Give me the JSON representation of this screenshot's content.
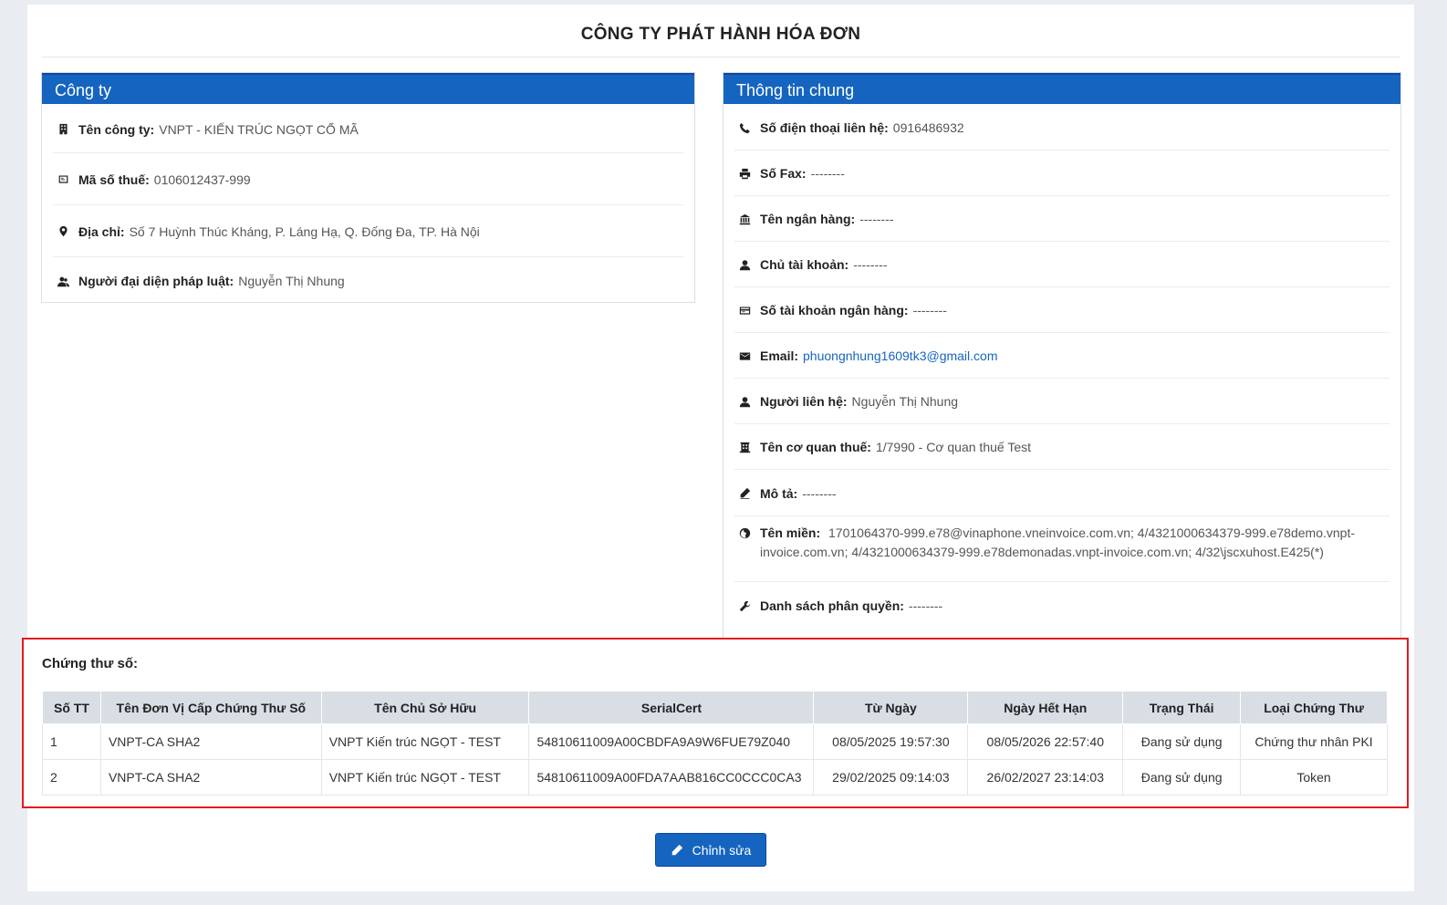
{
  "page_title": "CÔNG TY PHÁT HÀNH HÓA ĐƠN",
  "company_panel": {
    "title": "Công ty",
    "rows": [
      {
        "icon": "building-icon",
        "label": "Tên công ty:",
        "value": "VNPT - KIẾN TRÚC NGỌT CỔ MÃ"
      },
      {
        "icon": "id-card-icon",
        "label": "Mã số thuế:",
        "value": "0106012437-999"
      },
      {
        "icon": "map-marker-icon",
        "label": "Địa chỉ:",
        "value": "Số 7 Huỳnh Thúc Kháng, P. Láng Hạ, Q. Đống Đa, TP. Hà Nội"
      },
      {
        "icon": "users-icon",
        "label": "Người đại diện pháp luật:",
        "value": "Nguyễn Thị Nhung"
      }
    ]
  },
  "general_panel": {
    "title": "Thông tin chung",
    "rows": [
      {
        "icon": "phone-icon",
        "label": "Số điện thoại liên hệ:",
        "value": "0916486932"
      },
      {
        "icon": "fax-icon",
        "label": "Số Fax:",
        "value": "--------"
      },
      {
        "icon": "bank-icon",
        "label": "Tên ngân hàng:",
        "value": "--------"
      },
      {
        "icon": "user-icon",
        "label": "Chủ tài khoản:",
        "value": "--------"
      },
      {
        "icon": "credit-card-icon",
        "label": "Số tài khoản ngân hàng:",
        "value": "--------"
      },
      {
        "icon": "envelope-icon",
        "label": "Email:",
        "value": "phuongnhung1609tk3@gmail.com"
      },
      {
        "icon": "user-icon",
        "label": "Người liên hệ:",
        "value": "Nguyễn Thị Nhung"
      },
      {
        "icon": "building-icon",
        "label": "Tên cơ quan thuế:",
        "value": "1/7990 - Cơ quan thuế Test"
      },
      {
        "icon": "pencil-icon",
        "label": "Mô tả:",
        "value": "--------"
      },
      {
        "icon": "globe-icon",
        "label": "Tên miền:",
        "value": "1701064370-999.e78@vinaphone.vneinvoice.com.vn; 4/4321000634379-999.e78demo.vnpt-invoice.com.vn; 4/4321000634379-999.e78demonadas.vnpt-invoice.com.vn; 4/32\\jscxuhost.E425(*)"
      },
      {
        "icon": "wrench-icon",
        "label": "Danh sách phân quyền:",
        "value": "--------"
      }
    ]
  },
  "certificates": {
    "title": "Chứng thư số:",
    "columns": [
      "Số TT",
      "Tên Đơn Vị Cấp Chứng Thư Số",
      "Tên Chủ Sở Hữu",
      "SerialCert",
      "Từ Ngày",
      "Ngày Hết Hạn",
      "Trạng Thái",
      "Loại Chứng Thư"
    ],
    "rows": [
      [
        "1",
        "VNPT-CA SHA2",
        "VNPT Kiến trúc NGỌT - TEST",
        "54810611009A00CBDFA9A9W6FUE79Z040",
        "08/05/2025 19:57:30",
        "08/05/2026 22:57:40",
        "Đang sử dụng",
        "Chứng thư nhân PKI"
      ],
      [
        "2",
        "VNPT-CA SHA2",
        "VNPT Kiến trúc NGỌT - TEST",
        "54810611009A00FDA7AAB816CC0CCC0CA3",
        "29/02/2025 09:14:03",
        "26/02/2027 23:14:03",
        "Đang sử dụng",
        "Token"
      ]
    ]
  },
  "edit_button": {
    "label": "Chỉnh sửa",
    "icon": "pencil-icon"
  },
  "colors": {
    "primary": "#1565c0",
    "highlight_border": "#e11b22",
    "table_header": "#d9dee5"
  }
}
